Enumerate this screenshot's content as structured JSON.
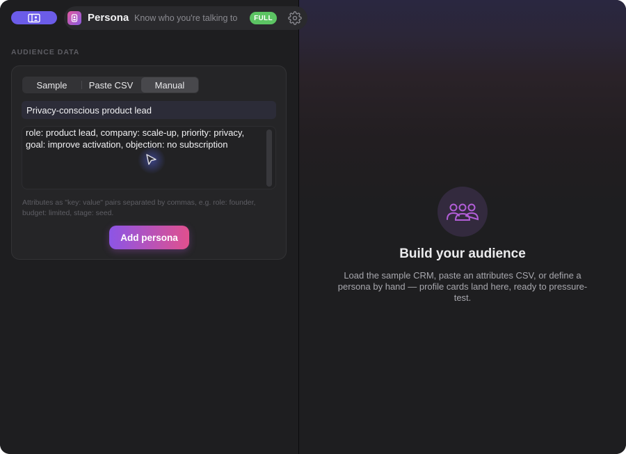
{
  "app": {
    "title": "Persona",
    "subtitle": "Know who you're talking to",
    "plan_badge": "FULL",
    "accent_color": "#6b5ce8",
    "icons": {
      "sidebar_toggle": "sidebar-icon",
      "app": "app-icon",
      "settings": "gear-icon",
      "empty_state": "people-group-icon"
    }
  },
  "sidebar": {
    "section_label": "AUDIENCE DATA",
    "tabs": [
      {
        "label": "Sample",
        "active": false
      },
      {
        "label": "Paste CSV",
        "active": false
      },
      {
        "label": "Manual",
        "active": true
      }
    ],
    "persona_name_value": "Privacy-conscious product lead",
    "attributes_value": "role: product lead, company: scale-up, priority: privacy, goal: improve activation, objection: no subscription",
    "helper_text": "Attributes as \"key: value\" pairs separated by commas, e.g. role: founder, budget: limited, stage: seed.",
    "add_button_label": "Add persona"
  },
  "main": {
    "empty_title": "Build your audience",
    "empty_description": "Load the sample CRM, paste an attributes CSV, or define a persona by hand — profile cards land here, ready to pressure-test."
  }
}
